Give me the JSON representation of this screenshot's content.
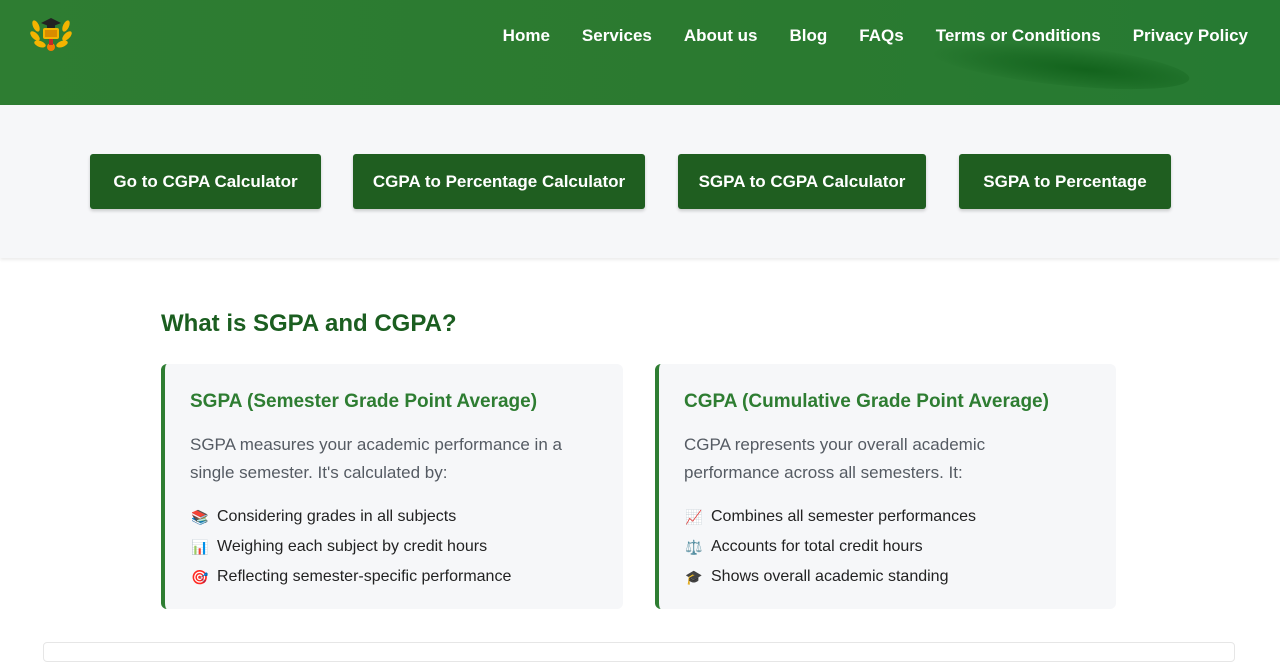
{
  "header": {
    "logo_icon": "graduation-laurel-logo-icon",
    "nav": [
      {
        "label": "Home"
      },
      {
        "label": "Services"
      },
      {
        "label": "About us"
      },
      {
        "label": "Blog"
      },
      {
        "label": "FAQs"
      },
      {
        "label": "Terms or Conditions"
      },
      {
        "label": "Privacy Policy"
      }
    ]
  },
  "buttons": [
    {
      "label": "Go to CGPA Calculator"
    },
    {
      "label": "CGPA to Percentage Calculator"
    },
    {
      "label": "SGPA to CGPA Calculator"
    },
    {
      "label": "SGPA to Percentage"
    }
  ],
  "section": {
    "title": "What is SGPA and CGPA?",
    "cards": [
      {
        "title": "SGPA (Semester Grade Point Average)",
        "description": "SGPA measures your academic performance in a single semester. It's calculated by:",
        "items": [
          {
            "icon": "books-icon",
            "glyph": "📚",
            "text": "Considering grades in all subjects"
          },
          {
            "icon": "bar-chart-icon",
            "glyph": "📊",
            "text": "Weighing each subject by credit hours"
          },
          {
            "icon": "target-icon",
            "glyph": "🎯",
            "text": "Reflecting semester-specific performance"
          }
        ]
      },
      {
        "title": "CGPA (Cumulative Grade Point Average)",
        "description": "CGPA represents your overall academic performance across all semesters. It:",
        "items": [
          {
            "icon": "trend-chart-icon",
            "glyph": "📈",
            "text": "Combines all semester performances"
          },
          {
            "icon": "scales-icon",
            "glyph": "⚖️",
            "text": "Accounts for total credit hours"
          },
          {
            "icon": "graduation-cap-icon",
            "glyph": "🎓",
            "text": "Shows overall academic standing"
          }
        ]
      }
    ]
  },
  "colors": {
    "header_green": "#2e7d32",
    "button_green": "#1f5e20",
    "title_green": "#1b5e20",
    "band_bg": "#f6f7f9"
  }
}
